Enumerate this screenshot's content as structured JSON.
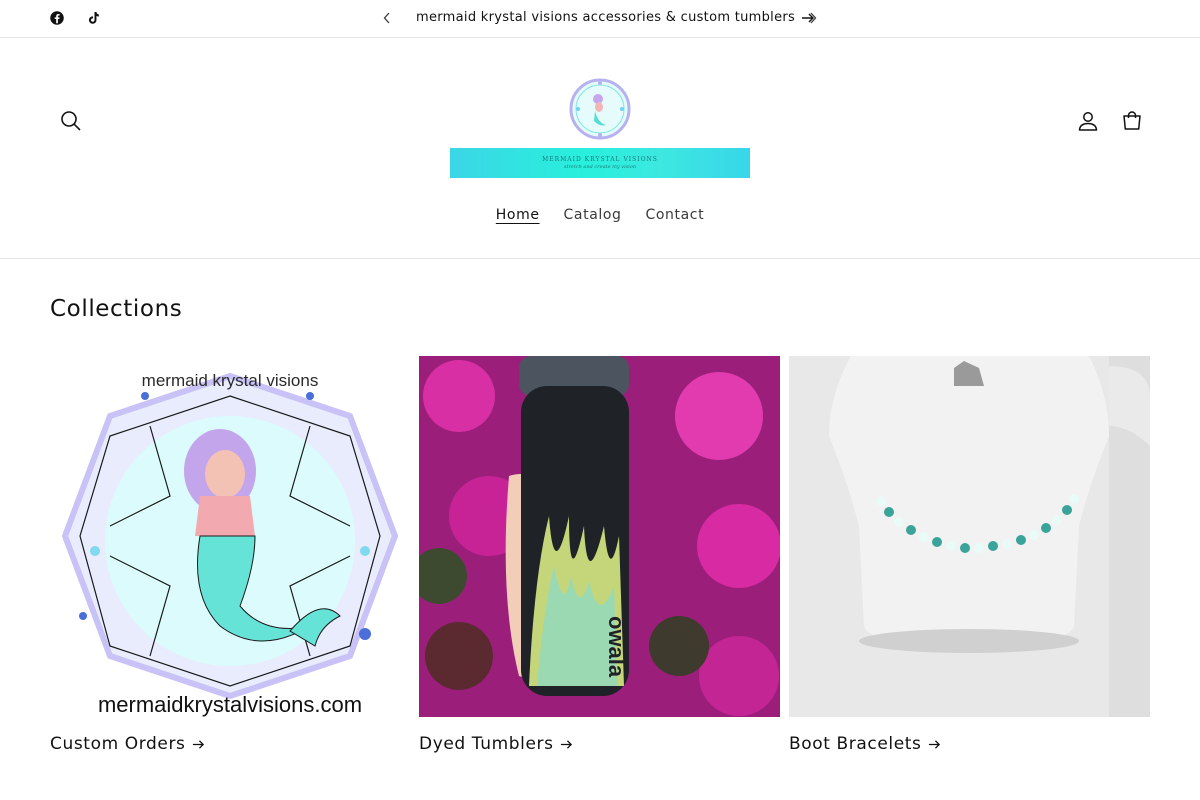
{
  "announcement": {
    "text": "mermaid krystal visions accessories & custom tumblers",
    "social": [
      "facebook-icon",
      "tiktok-icon"
    ]
  },
  "logo": {
    "banner_line1": "MERMAID KRYSTAL VISIONS",
    "banner_line2": "stretch and create my vision"
  },
  "nav": {
    "items": [
      {
        "label": "Home",
        "active": true
      },
      {
        "label": "Catalog",
        "active": false
      },
      {
        "label": "Contact",
        "active": false
      }
    ]
  },
  "collections": {
    "title": "Collections",
    "cards": [
      {
        "label": "Custom Orders",
        "image_text_top": "mermaid krystal visions",
        "image_text_bottom": "mermaidkrystalvisions.com"
      },
      {
        "label": "Dyed Tumblers",
        "image_text": "owala"
      },
      {
        "label": "Boot Bracelets"
      }
    ]
  },
  "colors": {
    "accent_teal": "#3ee0d8",
    "flowers_magenta": "#d0239c",
    "text": "#121212"
  }
}
